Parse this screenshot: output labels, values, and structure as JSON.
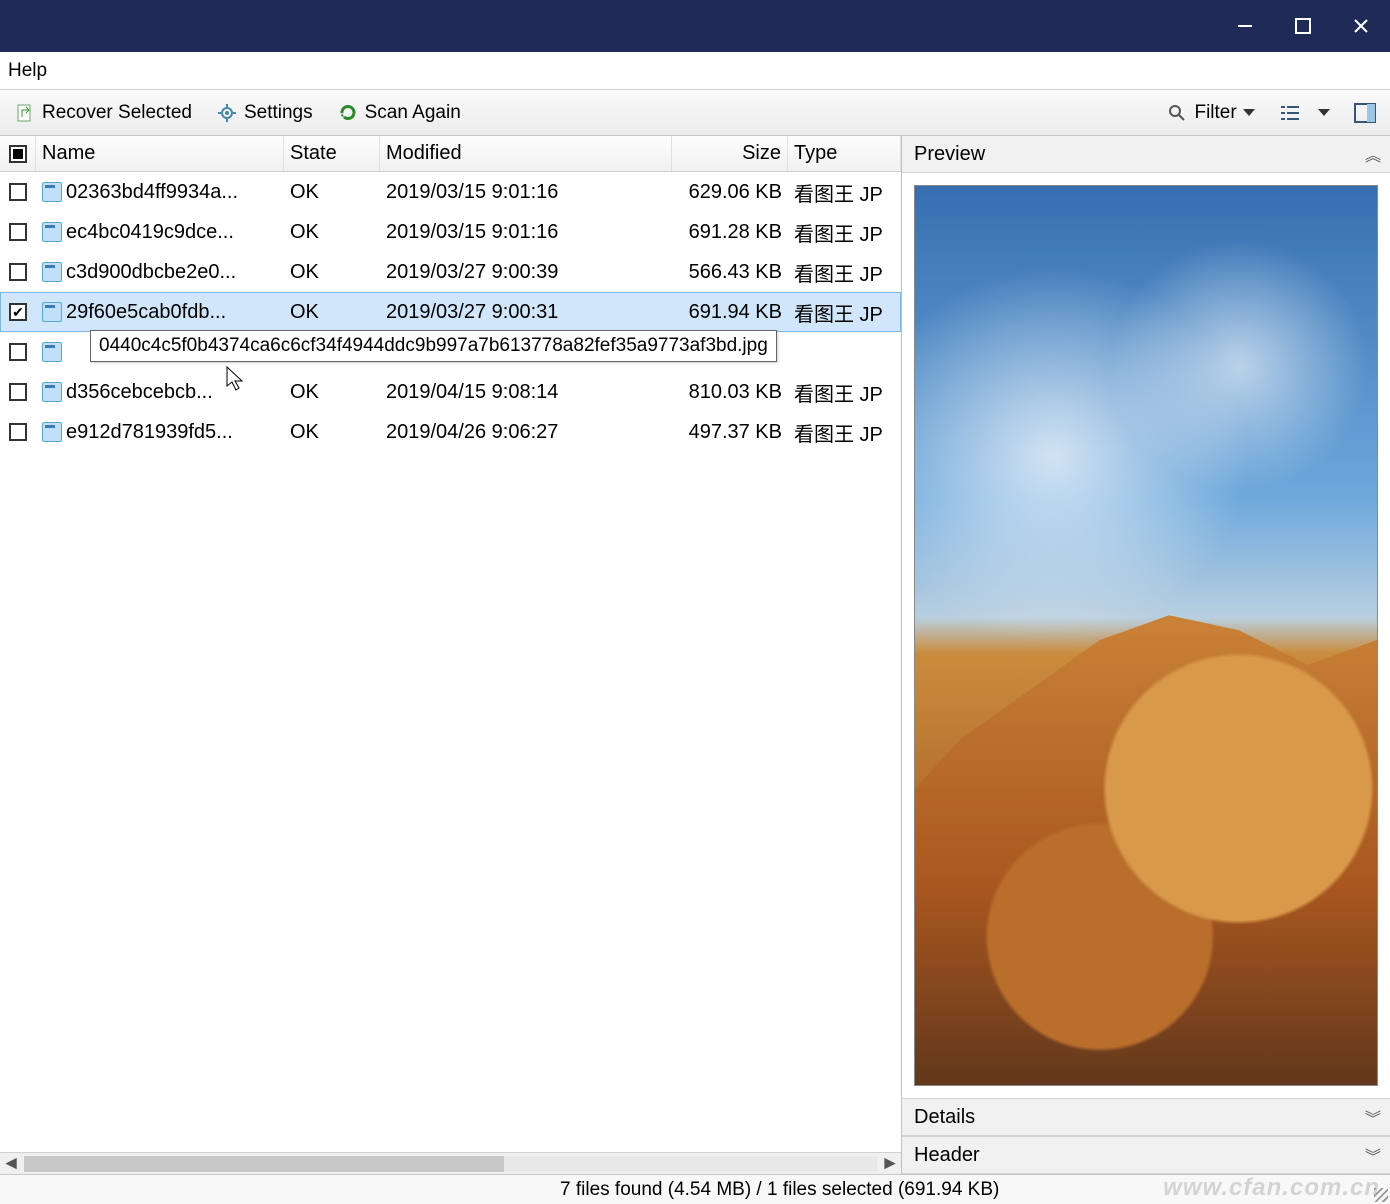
{
  "menubar": {
    "help": "Help"
  },
  "toolbar": {
    "recover": "Recover Selected",
    "settings": "Settings",
    "scan_again": "Scan Again",
    "filter": "Filter"
  },
  "columns": {
    "name": "Name",
    "state": "State",
    "modified": "Modified",
    "size": "Size",
    "type": "Type"
  },
  "rows": [
    {
      "checked": false,
      "name": "02363bd4ff9934a...",
      "state": "OK",
      "modified": "2019/03/15 9:01:16",
      "size": "629.06 KB",
      "type": "看图王 JP"
    },
    {
      "checked": false,
      "name": "ec4bc0419c9dce...",
      "state": "OK",
      "modified": "2019/03/15 9:01:16",
      "size": "691.28 KB",
      "type": "看图王 JP"
    },
    {
      "checked": false,
      "name": "c3d900dbcbe2e0...",
      "state": "OK",
      "modified": "2019/03/27 9:00:39",
      "size": "566.43 KB",
      "type": "看图王 JP"
    },
    {
      "checked": true,
      "name": "29f60e5cab0fdb...",
      "state": "OK",
      "modified": "2019/03/27 9:00:31",
      "size": "691.94 KB",
      "type": "看图王 JP",
      "selected": true
    },
    {
      "checked": false,
      "name": "",
      "state": "",
      "modified": "",
      "size": "",
      "type": ""
    },
    {
      "checked": false,
      "name": "d356cebcebcb...",
      "state": "OK",
      "modified": "2019/04/15 9:08:14",
      "size": "810.03 KB",
      "type": "看图王 JP"
    },
    {
      "checked": false,
      "name": "e912d781939fd5...",
      "state": "OK",
      "modified": "2019/04/26 9:06:27",
      "size": "497.37 KB",
      "type": "看图王 JP"
    }
  ],
  "tooltip": "0440c4c5f0b4374ca6c6cf34f4944ddc9b997a7b613778a82fef35a9773af3bd.jpg",
  "panels": {
    "preview": "Preview",
    "details": "Details",
    "header": "Header"
  },
  "statusbar": "7 files found (4.54 MB) / 1 files selected (691.94 KB)",
  "watermark": "www.cfan.com.cn"
}
